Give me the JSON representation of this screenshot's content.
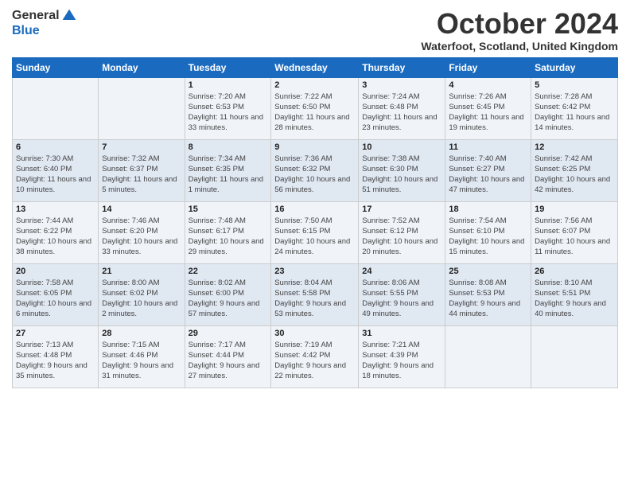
{
  "logo": {
    "general": "General",
    "blue": "Blue"
  },
  "title": "October 2024",
  "location": "Waterfoot, Scotland, United Kingdom",
  "headers": [
    "Sunday",
    "Monday",
    "Tuesday",
    "Wednesday",
    "Thursday",
    "Friday",
    "Saturday"
  ],
  "weeks": [
    [
      {
        "day": "",
        "sunrise": "",
        "sunset": "",
        "daylight": ""
      },
      {
        "day": "",
        "sunrise": "",
        "sunset": "",
        "daylight": ""
      },
      {
        "day": "1",
        "sunrise": "Sunrise: 7:20 AM",
        "sunset": "Sunset: 6:53 PM",
        "daylight": "Daylight: 11 hours and 33 minutes."
      },
      {
        "day": "2",
        "sunrise": "Sunrise: 7:22 AM",
        "sunset": "Sunset: 6:50 PM",
        "daylight": "Daylight: 11 hours and 28 minutes."
      },
      {
        "day": "3",
        "sunrise": "Sunrise: 7:24 AM",
        "sunset": "Sunset: 6:48 PM",
        "daylight": "Daylight: 11 hours and 23 minutes."
      },
      {
        "day": "4",
        "sunrise": "Sunrise: 7:26 AM",
        "sunset": "Sunset: 6:45 PM",
        "daylight": "Daylight: 11 hours and 19 minutes."
      },
      {
        "day": "5",
        "sunrise": "Sunrise: 7:28 AM",
        "sunset": "Sunset: 6:42 PM",
        "daylight": "Daylight: 11 hours and 14 minutes."
      }
    ],
    [
      {
        "day": "6",
        "sunrise": "Sunrise: 7:30 AM",
        "sunset": "Sunset: 6:40 PM",
        "daylight": "Daylight: 11 hours and 10 minutes."
      },
      {
        "day": "7",
        "sunrise": "Sunrise: 7:32 AM",
        "sunset": "Sunset: 6:37 PM",
        "daylight": "Daylight: 11 hours and 5 minutes."
      },
      {
        "day": "8",
        "sunrise": "Sunrise: 7:34 AM",
        "sunset": "Sunset: 6:35 PM",
        "daylight": "Daylight: 11 hours and 1 minute."
      },
      {
        "day": "9",
        "sunrise": "Sunrise: 7:36 AM",
        "sunset": "Sunset: 6:32 PM",
        "daylight": "Daylight: 10 hours and 56 minutes."
      },
      {
        "day": "10",
        "sunrise": "Sunrise: 7:38 AM",
        "sunset": "Sunset: 6:30 PM",
        "daylight": "Daylight: 10 hours and 51 minutes."
      },
      {
        "day": "11",
        "sunrise": "Sunrise: 7:40 AM",
        "sunset": "Sunset: 6:27 PM",
        "daylight": "Daylight: 10 hours and 47 minutes."
      },
      {
        "day": "12",
        "sunrise": "Sunrise: 7:42 AM",
        "sunset": "Sunset: 6:25 PM",
        "daylight": "Daylight: 10 hours and 42 minutes."
      }
    ],
    [
      {
        "day": "13",
        "sunrise": "Sunrise: 7:44 AM",
        "sunset": "Sunset: 6:22 PM",
        "daylight": "Daylight: 10 hours and 38 minutes."
      },
      {
        "day": "14",
        "sunrise": "Sunrise: 7:46 AM",
        "sunset": "Sunset: 6:20 PM",
        "daylight": "Daylight: 10 hours and 33 minutes."
      },
      {
        "day": "15",
        "sunrise": "Sunrise: 7:48 AM",
        "sunset": "Sunset: 6:17 PM",
        "daylight": "Daylight: 10 hours and 29 minutes."
      },
      {
        "day": "16",
        "sunrise": "Sunrise: 7:50 AM",
        "sunset": "Sunset: 6:15 PM",
        "daylight": "Daylight: 10 hours and 24 minutes."
      },
      {
        "day": "17",
        "sunrise": "Sunrise: 7:52 AM",
        "sunset": "Sunset: 6:12 PM",
        "daylight": "Daylight: 10 hours and 20 minutes."
      },
      {
        "day": "18",
        "sunrise": "Sunrise: 7:54 AM",
        "sunset": "Sunset: 6:10 PM",
        "daylight": "Daylight: 10 hours and 15 minutes."
      },
      {
        "day": "19",
        "sunrise": "Sunrise: 7:56 AM",
        "sunset": "Sunset: 6:07 PM",
        "daylight": "Daylight: 10 hours and 11 minutes."
      }
    ],
    [
      {
        "day": "20",
        "sunrise": "Sunrise: 7:58 AM",
        "sunset": "Sunset: 6:05 PM",
        "daylight": "Daylight: 10 hours and 6 minutes."
      },
      {
        "day": "21",
        "sunrise": "Sunrise: 8:00 AM",
        "sunset": "Sunset: 6:02 PM",
        "daylight": "Daylight: 10 hours and 2 minutes."
      },
      {
        "day": "22",
        "sunrise": "Sunrise: 8:02 AM",
        "sunset": "Sunset: 6:00 PM",
        "daylight": "Daylight: 9 hours and 57 minutes."
      },
      {
        "day": "23",
        "sunrise": "Sunrise: 8:04 AM",
        "sunset": "Sunset: 5:58 PM",
        "daylight": "Daylight: 9 hours and 53 minutes."
      },
      {
        "day": "24",
        "sunrise": "Sunrise: 8:06 AM",
        "sunset": "Sunset: 5:55 PM",
        "daylight": "Daylight: 9 hours and 49 minutes."
      },
      {
        "day": "25",
        "sunrise": "Sunrise: 8:08 AM",
        "sunset": "Sunset: 5:53 PM",
        "daylight": "Daylight: 9 hours and 44 minutes."
      },
      {
        "day": "26",
        "sunrise": "Sunrise: 8:10 AM",
        "sunset": "Sunset: 5:51 PM",
        "daylight": "Daylight: 9 hours and 40 minutes."
      }
    ],
    [
      {
        "day": "27",
        "sunrise": "Sunrise: 7:13 AM",
        "sunset": "Sunset: 4:48 PM",
        "daylight": "Daylight: 9 hours and 35 minutes."
      },
      {
        "day": "28",
        "sunrise": "Sunrise: 7:15 AM",
        "sunset": "Sunset: 4:46 PM",
        "daylight": "Daylight: 9 hours and 31 minutes."
      },
      {
        "day": "29",
        "sunrise": "Sunrise: 7:17 AM",
        "sunset": "Sunset: 4:44 PM",
        "daylight": "Daylight: 9 hours and 27 minutes."
      },
      {
        "day": "30",
        "sunrise": "Sunrise: 7:19 AM",
        "sunset": "Sunset: 4:42 PM",
        "daylight": "Daylight: 9 hours and 22 minutes."
      },
      {
        "day": "31",
        "sunrise": "Sunrise: 7:21 AM",
        "sunset": "Sunset: 4:39 PM",
        "daylight": "Daylight: 9 hours and 18 minutes."
      },
      {
        "day": "",
        "sunrise": "",
        "sunset": "",
        "daylight": ""
      },
      {
        "day": "",
        "sunrise": "",
        "sunset": "",
        "daylight": ""
      }
    ]
  ]
}
